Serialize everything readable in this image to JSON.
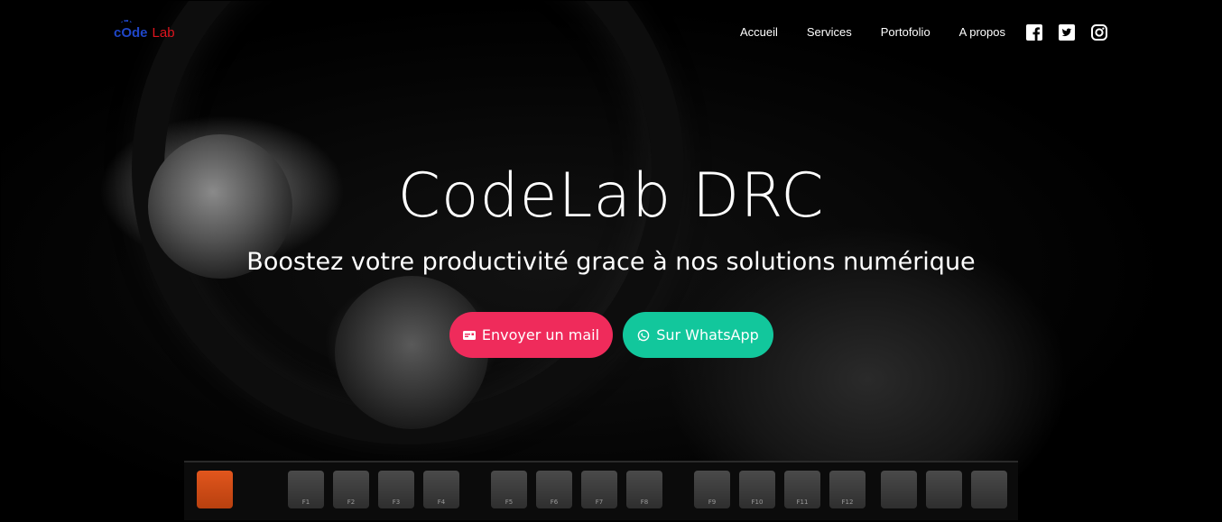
{
  "brand": {
    "code": "cOde",
    "lab": "Lab"
  },
  "nav": {
    "links": [
      "Accueil",
      "Services",
      "Portofolio",
      "A propos"
    ],
    "social": [
      "facebook-icon",
      "twitter-icon",
      "instagram-icon"
    ]
  },
  "hero": {
    "title": "CodeLab DRC",
    "subtitle": "Boostez votre productivité grace à nos solutions numérique",
    "buttons": {
      "mail": "Envoyer un mail",
      "whatsapp": "Sur WhatsApp"
    }
  },
  "keyboard": {
    "keys": [
      "",
      "",
      "F1",
      "F2",
      "F3",
      "F4",
      "F5",
      "F6",
      "F7",
      "F8",
      "F9",
      "F10",
      "F11",
      "F12",
      "",
      "",
      ""
    ]
  },
  "colors": {
    "mail_button": "#ef2b5b",
    "whatsapp_button": "#12c79c",
    "logo_code": "#1f46c8",
    "logo_lab": "#e0141e"
  }
}
